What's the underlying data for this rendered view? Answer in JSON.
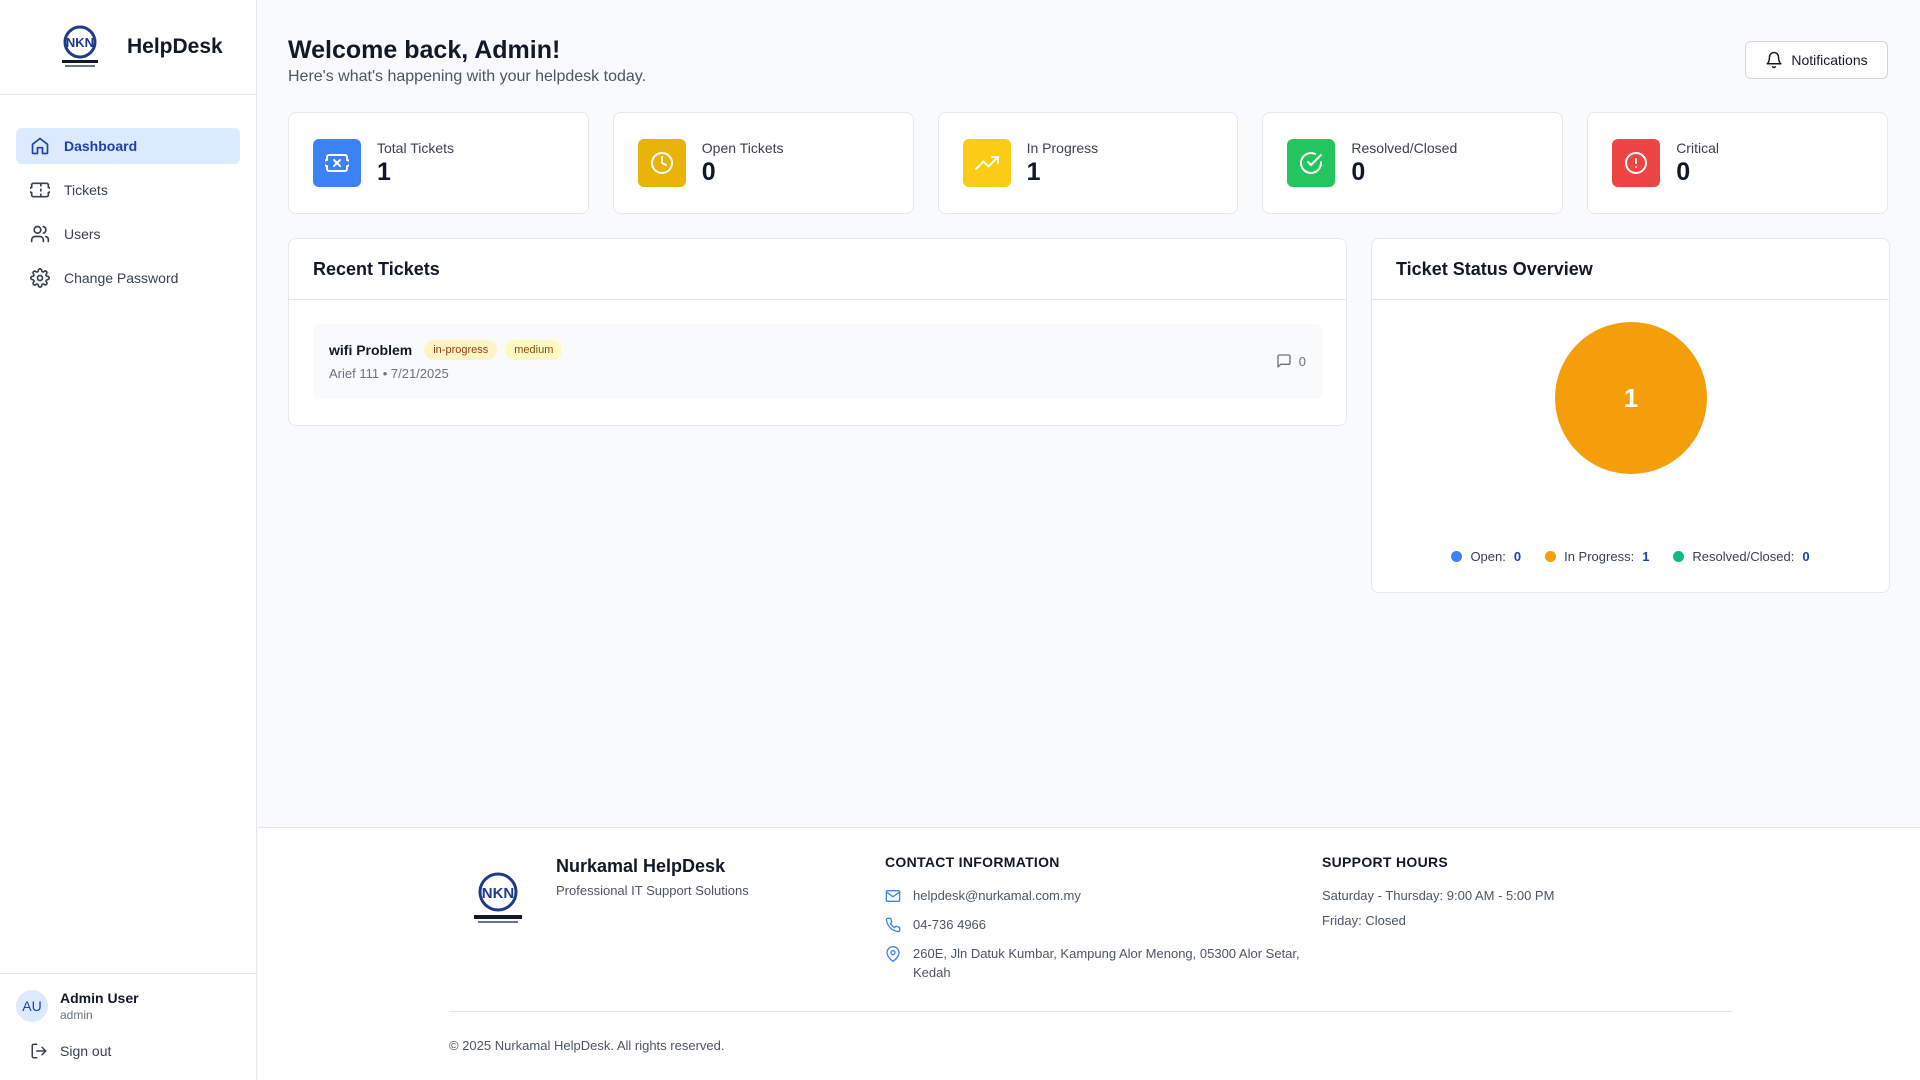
{
  "brand": {
    "app_name": "HelpDesk",
    "logo_text": "NKN"
  },
  "colors": {
    "primary": "#3b82f6",
    "accent_blue_text": "#1e40af",
    "open": "#3b82f6",
    "in_progress": "#f59e0b",
    "resolved": "#10b981",
    "critical": "#ef4444"
  },
  "sidebar": {
    "items": [
      {
        "label": "Dashboard",
        "icon": "home-icon",
        "active": true
      },
      {
        "label": "Tickets",
        "icon": "ticket-icon",
        "active": false
      },
      {
        "label": "Users",
        "icon": "users-icon",
        "active": false
      },
      {
        "label": "Change Password",
        "icon": "gear-icon",
        "active": false
      }
    ],
    "user": {
      "initials": "AU",
      "name": "Admin User",
      "role": "admin"
    },
    "signout_label": "Sign out"
  },
  "header": {
    "title": "Welcome back, Admin!",
    "subtitle": "Here's what's happening with your helpdesk today.",
    "notifications_label": "Notifications"
  },
  "stats": [
    {
      "label": "Total Tickets",
      "value": "1",
      "icon": "ticket-icon",
      "color": "#3b82f6"
    },
    {
      "label": "Open Tickets",
      "value": "0",
      "icon": "clock-icon",
      "color": "#eab308"
    },
    {
      "label": "In Progress",
      "value": "1",
      "icon": "trending-up-icon",
      "color": "#facc15"
    },
    {
      "label": "Resolved/Closed",
      "value": "0",
      "icon": "check-circle-icon",
      "color": "#22c55e"
    },
    {
      "label": "Critical",
      "value": "0",
      "icon": "alert-circle-icon",
      "color": "#ef4444"
    }
  ],
  "recent": {
    "title": "Recent Tickets",
    "tickets": [
      {
        "title": "wifi Problem",
        "status": "in-progress",
        "priority": "medium",
        "meta": "Arief 111 • 7/21/2025",
        "comments": "0"
      }
    ]
  },
  "overview": {
    "title": "Ticket Status Overview",
    "pie_label": "1",
    "legend": [
      {
        "label": "Open:",
        "value": "0",
        "color": "#3b82f6"
      },
      {
        "label": "In Progress:",
        "value": "1",
        "color": "#f59e0b"
      },
      {
        "label": "Resolved/Closed:",
        "value": "0",
        "color": "#10b981"
      }
    ]
  },
  "chart_data": {
    "type": "pie",
    "categories": [
      "Open",
      "In Progress",
      "Resolved/Closed"
    ],
    "values": [
      0,
      1,
      0
    ],
    "title": "Ticket Status Overview",
    "legend_position": "bottom"
  },
  "footer": {
    "name": "Nurkamal HelpDesk",
    "tagline": "Professional IT Support Solutions",
    "contact_heading": "CONTACT INFORMATION",
    "email": "helpdesk@nurkamal.com.my",
    "phone": "04-736 4966",
    "address": "260E, Jln Datuk Kumbar, Kampung Alor Menong, 05300 Alor Setar, Kedah",
    "hours_heading": "SUPPORT HOURS",
    "hours_line1": "Saturday - Thursday: 9:00 AM - 5:00 PM",
    "hours_line2": "Friday: Closed",
    "copyright": "© 2025 Nurkamal HelpDesk. All rights reserved."
  }
}
